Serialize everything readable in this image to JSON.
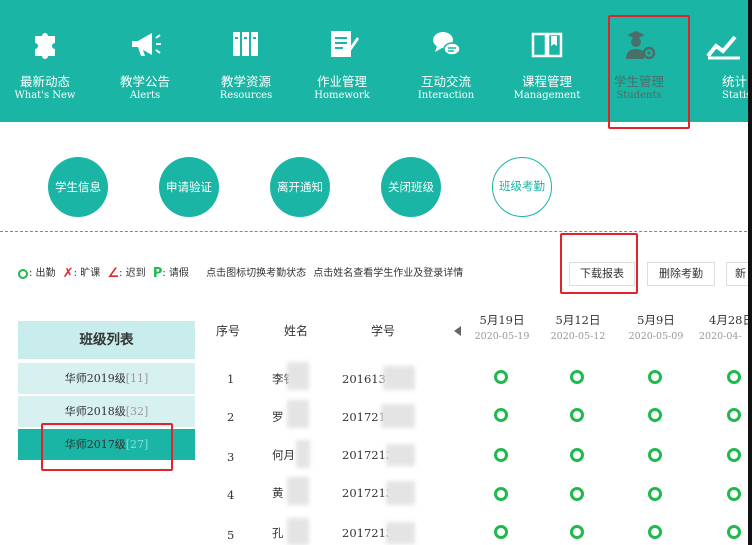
{
  "nav": {
    "items": [
      {
        "cn": "最新动态",
        "en": "What's New",
        "icon": "puzzle-icon"
      },
      {
        "cn": "教学公告",
        "en": "Alerts",
        "icon": "megaphone-icon"
      },
      {
        "cn": "教学资源",
        "en": "Resources",
        "icon": "books-icon"
      },
      {
        "cn": "作业管理",
        "en": "Homework",
        "icon": "document-pen-icon"
      },
      {
        "cn": "互动交流",
        "en": "Interaction",
        "icon": "chat-bubbles-icon"
      },
      {
        "cn": "课程管理",
        "en": "Management",
        "icon": "open-book-icon"
      },
      {
        "cn": "学生管理",
        "en": "Students",
        "icon": "student-gear-icon"
      },
      {
        "cn": "统计",
        "en": "Statis",
        "icon": "stats-chart-icon"
      }
    ],
    "active_index": 6
  },
  "subnav": [
    "学生信息",
    "申请验证",
    "离开通知",
    "关闭班级",
    "班级考勤"
  ],
  "legend": {
    "present_label": ": 出勤",
    "absent_label": ": 旷课",
    "late_label": ": 迟到",
    "leave_label": ": 请假",
    "hint1": "点击图标切换考勤状态",
    "hint2": "点击姓名查看学生作业及登录详情"
  },
  "actions": {
    "download": "下载报表",
    "delete": "删除考勤",
    "new": "新"
  },
  "classlist": {
    "title": "班级列表",
    "items": [
      {
        "name": "华师2019级",
        "count": "[11]"
      },
      {
        "name": "华师2018级",
        "count": "[32]"
      },
      {
        "name": "华师2017级",
        "count": "[27]"
      }
    ],
    "active_index": 2
  },
  "table": {
    "headers": {
      "index": "序号",
      "name": "姓名",
      "student_id": "学号"
    },
    "dates": [
      {
        "label": "5月19日",
        "date": "2020-05-19"
      },
      {
        "label": "5月12日",
        "date": "2020-05-12"
      },
      {
        "label": "5月9日",
        "date": "2020-05-09"
      },
      {
        "label": "4月28日",
        "date": "2020-04-"
      }
    ],
    "rows": [
      {
        "index": "1",
        "name": "李钅",
        "student_id": "201613",
        "marks": [
          "present",
          "present",
          "present",
          "present"
        ]
      },
      {
        "index": "2",
        "name": "罗",
        "student_id": "201721",
        "marks": [
          "present",
          "present",
          "present",
          "present"
        ]
      },
      {
        "index": "3",
        "name": "何月",
        "student_id": "2017213",
        "marks": [
          "present",
          "present",
          "present",
          "present"
        ]
      },
      {
        "index": "4",
        "name": "黄",
        "student_id": "2017213",
        "marks": [
          "present",
          "present",
          "present",
          "present"
        ]
      },
      {
        "index": "5",
        "name": "孔",
        "student_id": "2017213",
        "marks": [
          "present",
          "present",
          "present",
          "present"
        ]
      }
    ]
  },
  "colors": {
    "accent": "#1ab5a4",
    "present": "#1fb94d",
    "absent": "#e0242b",
    "highlight": "#e0242b"
  }
}
